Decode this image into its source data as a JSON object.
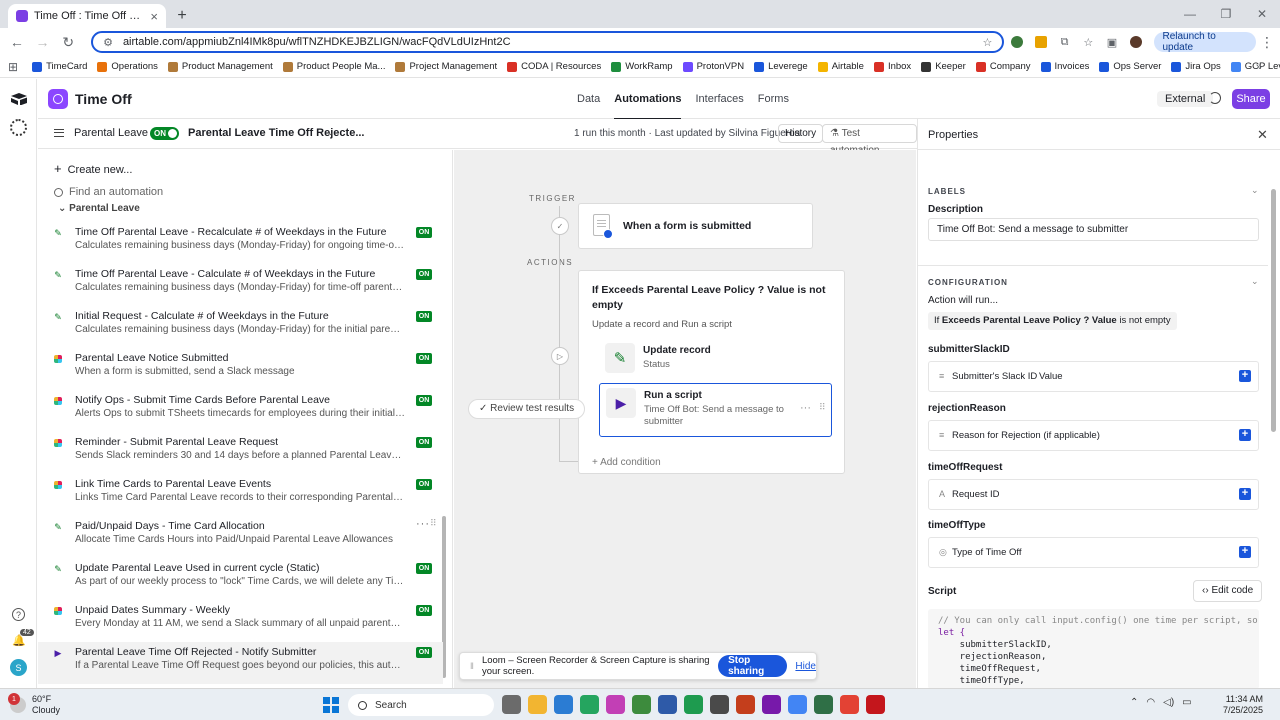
{
  "browser": {
    "tab_title": "Time Off : Time Off Requests - A",
    "url": "airtable.com/appmiubZnl4IMk8pu/wflTNZHDKEJBZLIGN/wacFQdVLdUIzHnt2C",
    "relaunch_label": "Relaunch to update",
    "bookmarks": [
      "TimeCard",
      "Operations",
      "Product Management",
      "Product People Ma...",
      "Project Management",
      "CODA | Resources",
      "WorkRamp",
      "ProtonVPN",
      "Leverege",
      "Airtable",
      "Inbox",
      "Keeper",
      "Company",
      "Invoices",
      "Ops Server",
      "Jira Ops",
      "GCP Leverege"
    ],
    "bookmark_colors": [
      "#1a56db",
      "#e8710a",
      "#b07a3a",
      "#b07a3a",
      "#b07a3a",
      "#d93025",
      "#1e8e3e",
      "#6d4aff",
      "#1a56db",
      "#f4b400",
      "#d93025",
      "#333333",
      "#d93025",
      "#1a56db",
      "#1a56db",
      "#1a56db",
      "#4285f4"
    ]
  },
  "rail": {
    "notification_count": "42",
    "avatar_letter": "S"
  },
  "header": {
    "base_name": "Time Off",
    "nav": [
      "Data",
      "Automations",
      "Interfaces",
      "Forms"
    ],
    "external": "External",
    "share": "Share"
  },
  "subheader": {
    "folder": "Parental Leave",
    "toggle": "ON",
    "automation_name": "Parental Leave Time Off Rejecte...",
    "run_info": "1 run this month · Last updated by Silvina Figueroa",
    "history": "History",
    "test": "Test automation"
  },
  "list": {
    "create": "Create new...",
    "find": "Find an automation",
    "group": "Parental Leave",
    "items": [
      {
        "icon": "pencil",
        "name": "Time Off Parental Leave - Recalculate # of Weekdays in the Future",
        "desc": "Calculates remaining business days (Monday-Friday) for ongoing time-off parental le...",
        "status": "ON"
      },
      {
        "icon": "pencil",
        "name": "Time Off Parental Leave - Calculate # of Weekdays in the Future",
        "desc": "Calculates remaining business days (Monday-Friday) for time-off parental leave requ...",
        "status": "ON"
      },
      {
        "icon": "pencil",
        "name": "Initial Request - Calculate # of Weekdays in the Future",
        "desc": "Calculates remaining business days (Monday-Friday) for the initial parental leave req...",
        "status": "ON"
      },
      {
        "icon": "slack",
        "name": "Parental Leave Notice Submitted",
        "desc": "When a form is submitted, send a Slack message",
        "status": "ON"
      },
      {
        "icon": "slack",
        "name": "Notify Ops - Submit Time Cards Before Parental Leave",
        "desc": "Alerts Ops to submit TSheets timecards for employees during their initial Parental Le...",
        "status": "ON"
      },
      {
        "icon": "slack",
        "name": "Reminder - Submit Parental Leave Request",
        "desc": "Sends Slack reminders 30 and 14 days before a planned Parental Leave start to prom...",
        "status": "ON"
      },
      {
        "icon": "slack",
        "name": "Link Time Cards to Parental Leave Events",
        "desc": "Links Time Card Parental Leave records to their corresponding Parental Leave events",
        "status": "ON"
      },
      {
        "icon": "pencil",
        "name": "Paid/Unpaid Days - Time Card Allocation",
        "desc": "Allocate Time Cards Hours into Paid/Unpaid Parental Leave Allowances",
        "status": ""
      },
      {
        "icon": "pencil",
        "name": "Update Parental Leave Used in current cycle (Static)",
        "desc": "As part of our weekly process to \"lock\" Time Cards, we will delete any Time Cards ad...",
        "status": "ON"
      },
      {
        "icon": "slack",
        "name": "Unpaid Dates Summary - Weekly",
        "desc": "Every Monday at 11 AM, we send a Slack summary of all unpaid parental leave days l...",
        "status": "ON"
      },
      {
        "icon": "play",
        "name": "Parental Leave Time Off Rejected - Notify Submitter",
        "desc": "If a Parental Leave Time Off Request goes beyond our policies, this automation mark...",
        "status": "ON"
      }
    ]
  },
  "canvas": {
    "trigger_label": "TRIGGER",
    "actions_label": "ACTIONS",
    "trigger_title": "When a form is submitted",
    "condition_title": "If Exceeds Parental Leave Policy ? Value is not empty",
    "condition_sub": "Update a record and Run a script",
    "action1_title": "Update record",
    "action1_sub": "Status",
    "action2_title": "Run a script",
    "action2_sub": "Time Off Bot: Send a message to submitter",
    "add_condition": "+ Add condition",
    "review": "Review test results"
  },
  "loom": {
    "message": "Loom – Screen Recorder & Screen Capture is sharing your screen.",
    "stop": "Stop sharing",
    "hide": "Hide"
  },
  "properties": {
    "title": "Properties",
    "labels_section": "LABELS",
    "description_label": "Description",
    "description_value": "Time Off Bot: Send a message to submitter",
    "config_section": "CONFIGURATION",
    "action_will_run": "Action will run...",
    "cond_prefix": "If",
    "cond_field": "Exceeds Parental Leave Policy ? Value",
    "cond_suffix": "is not empty",
    "inputs": [
      {
        "name": "submitterSlackID",
        "token": "Submitter's Slack ID",
        "extra": "Value"
      },
      {
        "name": "rejectionReason",
        "token": "Reason for Rejection (if applicable)",
        "extra": ""
      },
      {
        "name": "timeOffRequest",
        "token": "Request ID",
        "extra": ""
      },
      {
        "name": "timeOffType",
        "token": "Type of Time Off",
        "extra": ""
      }
    ],
    "script_label": "Script",
    "edit_code": "Edit code",
    "code_comment": "// You can only call input.config() one time per script, so here",
    "code_kw": "let {",
    "code_lines": [
      "    submitterSlackID,",
      "    rejectionReason,",
      "    timeOffRequest,",
      "    timeOffType,"
    ]
  },
  "taskbar": {
    "weather_badge": "1",
    "temp": "60°F",
    "cond": "Cloudy",
    "search": "Search",
    "time": "11:34 AM",
    "date": "7/25/2025"
  }
}
